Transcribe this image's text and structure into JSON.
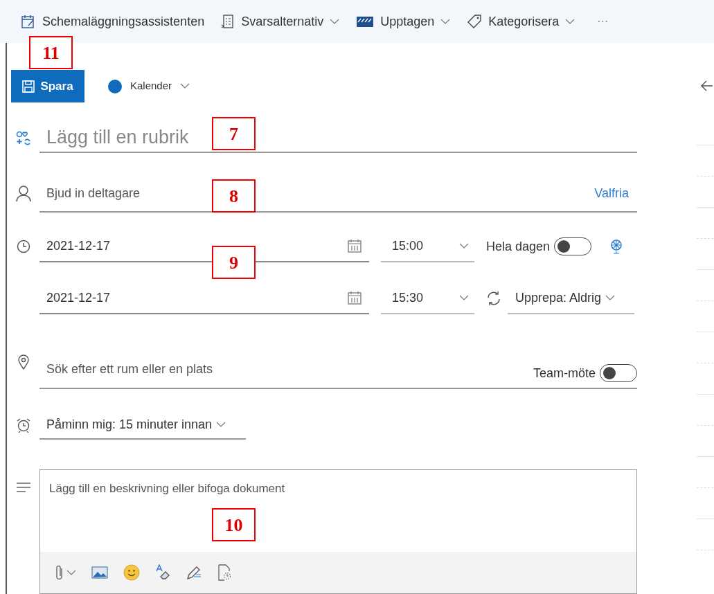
{
  "toolbar": {
    "items": [
      {
        "label": "Schemaläggningsassistenten",
        "kind": "button"
      },
      {
        "label": "Svarsalternativ",
        "kind": "dropdown"
      },
      {
        "label": "Upptagen",
        "kind": "dropdown"
      },
      {
        "label": "Kategorisera",
        "kind": "dropdown"
      }
    ],
    "more": "···"
  },
  "save_button": {
    "label": "Spara"
  },
  "calendar_picker": {
    "label": "Kalender"
  },
  "title_field": {
    "placeholder": "Lägg till en rubrik"
  },
  "attendees_field": {
    "placeholder": "Bjud in deltagare",
    "optional_link": "Valfria"
  },
  "start": {
    "date": "2021-12-17",
    "time": "15:00"
  },
  "end": {
    "date": "2021-12-17",
    "time": "15:30"
  },
  "all_day": {
    "label": "Hela dagen",
    "on": false
  },
  "repeat": {
    "label": "Upprepa: Aldrig"
  },
  "location_field": {
    "placeholder": "Sök efter ett rum eller en plats"
  },
  "teams_meeting": {
    "label": "Team-möte",
    "on": false
  },
  "reminder": {
    "label": "Påminn mig: 15 minuter innan"
  },
  "description": {
    "placeholder": "Lägg till en beskrivning eller bifoga dokument"
  },
  "annotations": [
    {
      "label": "11"
    },
    {
      "label": "7"
    },
    {
      "label": "8"
    },
    {
      "label": "9"
    },
    {
      "label": "10"
    }
  ]
}
